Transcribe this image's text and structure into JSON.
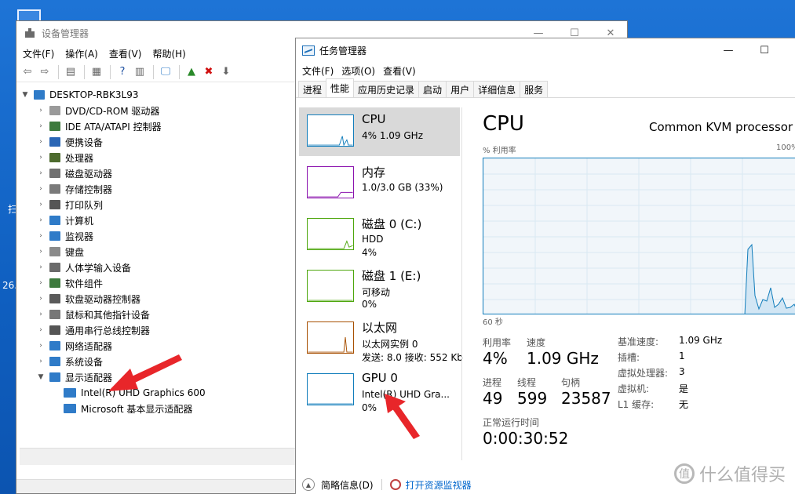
{
  "desktop": {
    "frag_1": "扫",
    "frag_2": "26."
  },
  "device_manager": {
    "title": "设备管理器",
    "menu": [
      "文件(F)",
      "操作(A)",
      "查看(V)",
      "帮助(H)"
    ],
    "root": "DESKTOP-RBK3L93",
    "items": [
      {
        "label": "DVD/CD-ROM 驱动器",
        "icon_color": "#9a9a9a"
      },
      {
        "label": "IDE ATA/ATAPI 控制器",
        "icon_color": "#3d7a3d"
      },
      {
        "label": "便携设备",
        "icon_color": "#2a66b5"
      },
      {
        "label": "处理器",
        "icon_color": "#4d6b2e"
      },
      {
        "label": "磁盘驱动器",
        "icon_color": "#707070"
      },
      {
        "label": "存储控制器",
        "icon_color": "#7a7a7a"
      },
      {
        "label": "打印队列",
        "icon_color": "#555555"
      },
      {
        "label": "计算机",
        "icon_color": "#2f7bc8"
      },
      {
        "label": "监视器",
        "icon_color": "#2f7bc8"
      },
      {
        "label": "键盘",
        "icon_color": "#8a8a8a"
      },
      {
        "label": "人体学输入设备",
        "icon_color": "#6a6a6a"
      },
      {
        "label": "软件组件",
        "icon_color": "#3d7a3d"
      },
      {
        "label": "软盘驱动器控制器",
        "icon_color": "#5a5a5a"
      },
      {
        "label": "鼠标和其他指针设备",
        "icon_color": "#777777"
      },
      {
        "label": "通用串行总线控制器",
        "icon_color": "#555555"
      },
      {
        "label": "网络适配器",
        "icon_color": "#2f7bc8"
      },
      {
        "label": "系统设备",
        "icon_color": "#2f7bc8"
      },
      {
        "label": "显示适配器",
        "icon_color": "#2f7bc8"
      }
    ],
    "children": [
      "Intel(R) UHD Graphics 600",
      "Microsoft 基本显示适配器"
    ]
  },
  "task_manager": {
    "title": "任务管理器",
    "menu": [
      "文件(F)",
      "选项(O)",
      "查看(V)"
    ],
    "tabs": [
      "进程",
      "性能",
      "应用历史记录",
      "启动",
      "用户",
      "详细信息",
      "服务"
    ],
    "active_tab": "性能",
    "side": [
      {
        "name": "CPU",
        "sub1": "4% 1.09 GHz",
        "sub2": "",
        "color": "#117dbb"
      },
      {
        "name": "内存",
        "sub1": "1.0/3.0 GB (33%)",
        "sub2": "",
        "color": "#8b12ae"
      },
      {
        "name": "磁盘 0 (C:)",
        "sub1": "HDD",
        "sub2": "4%",
        "color": "#4da60c"
      },
      {
        "name": "磁盘 1 (E:)",
        "sub1": "可移动",
        "sub2": "0%",
        "color": "#4da60c"
      },
      {
        "name": "以太网",
        "sub1": "以太网实例 0",
        "sub2": "发送: 8.0 接收: 552 Kb",
        "color": "#a74f01"
      },
      {
        "name": "GPU 0",
        "sub1": "Intel(R) UHD Gra...",
        "sub2": "0%",
        "color": "#117dbb"
      }
    ],
    "detail": {
      "title": "CPU",
      "model": "Common KVM processor",
      "axis_left": "% 利用率",
      "axis_right": "100%",
      "time_left": "60 秒",
      "stats": {
        "util_label": "利用率",
        "util": "4%",
        "speed_label": "速度",
        "speed": "1.09 GHz",
        "proc_label": "进程",
        "proc": "49",
        "thread_label": "线程",
        "thread": "599",
        "handle_label": "句柄",
        "handle": "23587",
        "uptime_label": "正常运行时间",
        "uptime": "0:00:30:52"
      },
      "kv": [
        {
          "k": "基准速度:",
          "v": "1.09 GHz"
        },
        {
          "k": "插槽:",
          "v": "1"
        },
        {
          "k": "虚拟处理器:",
          "v": "3"
        },
        {
          "k": "虚拟机:",
          "v": "是"
        },
        {
          "k": "L1 缓存:",
          "v": "无"
        }
      ]
    },
    "footer": {
      "brief": "简略信息(D)",
      "resmon": "打开资源监视器"
    }
  },
  "watermark": {
    "text": "什么值得买",
    "logo": "值"
  }
}
